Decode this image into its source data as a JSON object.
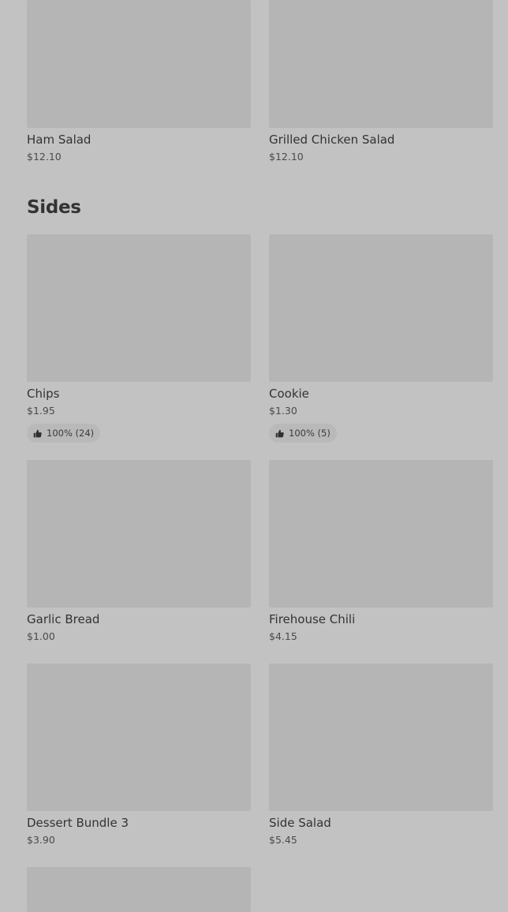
{
  "sections": {
    "salads": {
      "items": [
        {
          "name": "Ham Salad",
          "price": "$12.10"
        },
        {
          "name": "Grilled Chicken Salad",
          "price": "$12.10"
        }
      ]
    },
    "sides": {
      "title": "Sides",
      "items": [
        {
          "name": "Chips",
          "price": "$1.95",
          "rating": "100% (24)"
        },
        {
          "name": "Cookie",
          "price": "$1.30",
          "rating": "100% (5)"
        },
        {
          "name": "Garlic Bread",
          "price": "$1.00"
        },
        {
          "name": "Firehouse Chili",
          "price": "$4.15"
        },
        {
          "name": "Dessert Bundle 3",
          "price": "$3.90"
        },
        {
          "name": "Side Salad",
          "price": "$5.45"
        }
      ]
    }
  },
  "icons": {
    "rating": "thumbs-up-icon"
  }
}
